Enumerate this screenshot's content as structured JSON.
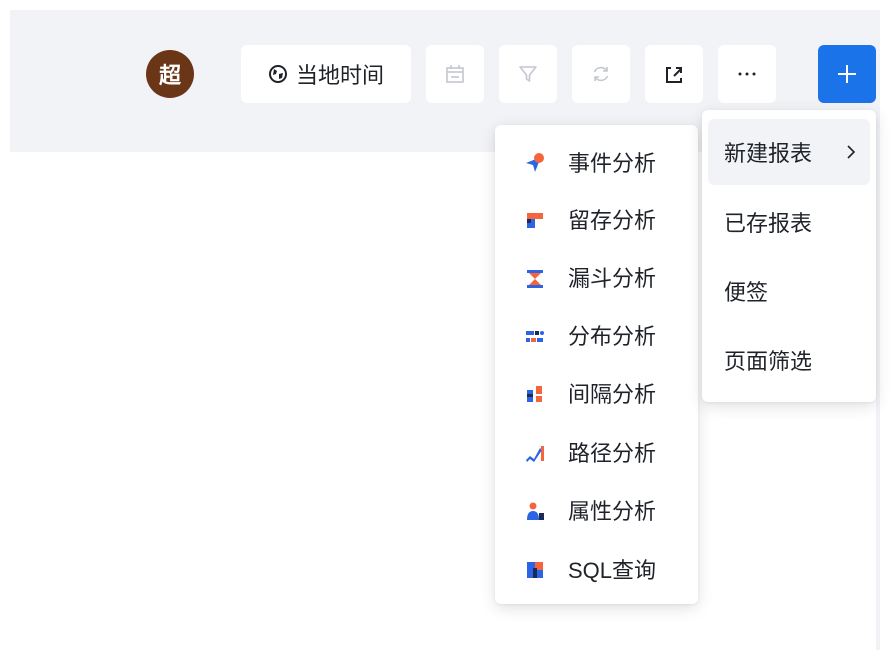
{
  "header": {
    "avatar_text": "超",
    "time_label": "当地时间",
    "icons": [
      "globe-icon",
      "calendar-icon",
      "filter-icon",
      "refresh-icon",
      "share-icon",
      "more-icon",
      "plus-icon"
    ]
  },
  "main_menu": {
    "items": [
      {
        "label": "新建报表",
        "active": true
      },
      {
        "label": "已存报表"
      },
      {
        "label": "便签"
      },
      {
        "label": "页面筛选"
      }
    ]
  },
  "sub_menu": {
    "items": [
      {
        "label": "事件分析",
        "icon": "event-analysis-icon"
      },
      {
        "label": "留存分析",
        "icon": "retention-analysis-icon"
      },
      {
        "label": "漏斗分析",
        "icon": "funnel-analysis-icon"
      },
      {
        "label": "分布分析",
        "icon": "distribution-analysis-icon"
      },
      {
        "label": "间隔分析",
        "icon": "interval-analysis-icon"
      },
      {
        "label": "路径分析",
        "icon": "path-analysis-icon"
      },
      {
        "label": "属性分析",
        "icon": "attribute-analysis-icon"
      },
      {
        "label": "SQL查询",
        "icon": "sql-query-icon"
      }
    ]
  },
  "colors": {
    "accent": "#1a73e8",
    "icon_blue": "#2b65e6",
    "icon_orange": "#f5653d",
    "icon_dark": "#1d2a55",
    "avatar_bg": "#6a3617",
    "toolbar_bg": "#f2f3f6"
  }
}
